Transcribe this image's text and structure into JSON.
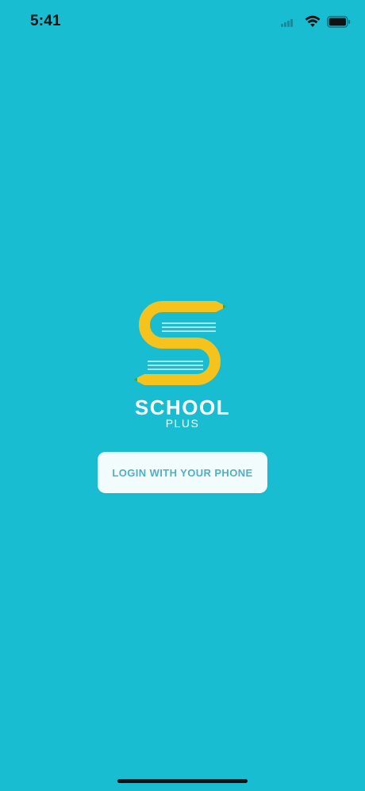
{
  "status_bar": {
    "time": "5:41"
  },
  "brand": {
    "name": "SCHOOL",
    "subtitle": "PLUS"
  },
  "actions": {
    "login_label": "LOGIN WITH YOUR PHONE"
  },
  "icons": {
    "logo": "pencil-s-logo-icon",
    "signal": "cellular-signal-icon",
    "wifi": "wifi-icon",
    "battery": "battery-icon"
  },
  "colors": {
    "background": "#19BDD2",
    "logo_yellow": "#F6C21C",
    "pencil_tip": "#3FA548",
    "button_bg": "#F2FCFD",
    "button_text": "#4FB0C4"
  }
}
